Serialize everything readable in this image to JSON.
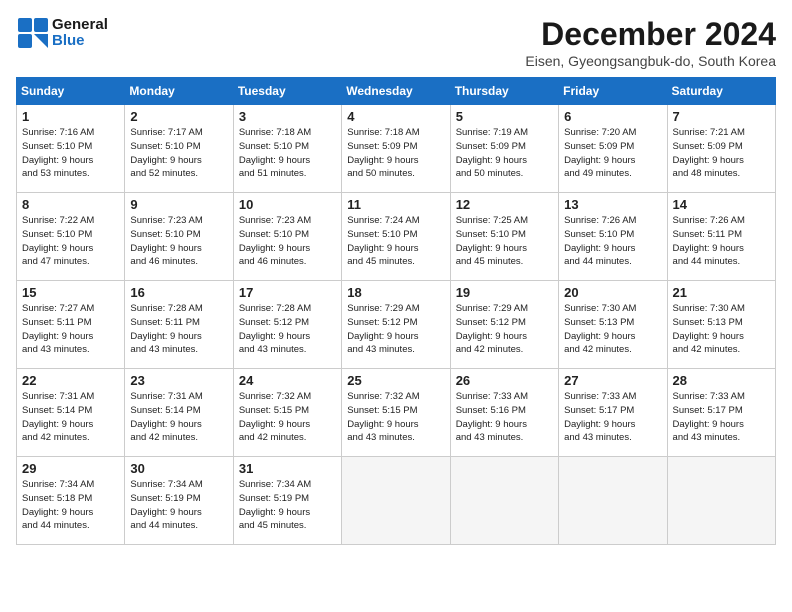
{
  "header": {
    "logo_general": "General",
    "logo_blue": "Blue",
    "month_title": "December 2024",
    "location": "Eisen, Gyeongsangbuk-do, South Korea"
  },
  "weekdays": [
    "Sunday",
    "Monday",
    "Tuesday",
    "Wednesday",
    "Thursday",
    "Friday",
    "Saturday"
  ],
  "weeks": [
    [
      {
        "day": 1,
        "info": "Sunrise: 7:16 AM\nSunset: 5:10 PM\nDaylight: 9 hours\nand 53 minutes."
      },
      {
        "day": 2,
        "info": "Sunrise: 7:17 AM\nSunset: 5:10 PM\nDaylight: 9 hours\nand 52 minutes."
      },
      {
        "day": 3,
        "info": "Sunrise: 7:18 AM\nSunset: 5:10 PM\nDaylight: 9 hours\nand 51 minutes."
      },
      {
        "day": 4,
        "info": "Sunrise: 7:18 AM\nSunset: 5:09 PM\nDaylight: 9 hours\nand 50 minutes."
      },
      {
        "day": 5,
        "info": "Sunrise: 7:19 AM\nSunset: 5:09 PM\nDaylight: 9 hours\nand 50 minutes."
      },
      {
        "day": 6,
        "info": "Sunrise: 7:20 AM\nSunset: 5:09 PM\nDaylight: 9 hours\nand 49 minutes."
      },
      {
        "day": 7,
        "info": "Sunrise: 7:21 AM\nSunset: 5:09 PM\nDaylight: 9 hours\nand 48 minutes."
      }
    ],
    [
      {
        "day": 8,
        "info": "Sunrise: 7:22 AM\nSunset: 5:10 PM\nDaylight: 9 hours\nand 47 minutes."
      },
      {
        "day": 9,
        "info": "Sunrise: 7:23 AM\nSunset: 5:10 PM\nDaylight: 9 hours\nand 46 minutes."
      },
      {
        "day": 10,
        "info": "Sunrise: 7:23 AM\nSunset: 5:10 PM\nDaylight: 9 hours\nand 46 minutes."
      },
      {
        "day": 11,
        "info": "Sunrise: 7:24 AM\nSunset: 5:10 PM\nDaylight: 9 hours\nand 45 minutes."
      },
      {
        "day": 12,
        "info": "Sunrise: 7:25 AM\nSunset: 5:10 PM\nDaylight: 9 hours\nand 45 minutes."
      },
      {
        "day": 13,
        "info": "Sunrise: 7:26 AM\nSunset: 5:10 PM\nDaylight: 9 hours\nand 44 minutes."
      },
      {
        "day": 14,
        "info": "Sunrise: 7:26 AM\nSunset: 5:11 PM\nDaylight: 9 hours\nand 44 minutes."
      }
    ],
    [
      {
        "day": 15,
        "info": "Sunrise: 7:27 AM\nSunset: 5:11 PM\nDaylight: 9 hours\nand 43 minutes."
      },
      {
        "day": 16,
        "info": "Sunrise: 7:28 AM\nSunset: 5:11 PM\nDaylight: 9 hours\nand 43 minutes."
      },
      {
        "day": 17,
        "info": "Sunrise: 7:28 AM\nSunset: 5:12 PM\nDaylight: 9 hours\nand 43 minutes."
      },
      {
        "day": 18,
        "info": "Sunrise: 7:29 AM\nSunset: 5:12 PM\nDaylight: 9 hours\nand 43 minutes."
      },
      {
        "day": 19,
        "info": "Sunrise: 7:29 AM\nSunset: 5:12 PM\nDaylight: 9 hours\nand 42 minutes."
      },
      {
        "day": 20,
        "info": "Sunrise: 7:30 AM\nSunset: 5:13 PM\nDaylight: 9 hours\nand 42 minutes."
      },
      {
        "day": 21,
        "info": "Sunrise: 7:30 AM\nSunset: 5:13 PM\nDaylight: 9 hours\nand 42 minutes."
      }
    ],
    [
      {
        "day": 22,
        "info": "Sunrise: 7:31 AM\nSunset: 5:14 PM\nDaylight: 9 hours\nand 42 minutes."
      },
      {
        "day": 23,
        "info": "Sunrise: 7:31 AM\nSunset: 5:14 PM\nDaylight: 9 hours\nand 42 minutes."
      },
      {
        "day": 24,
        "info": "Sunrise: 7:32 AM\nSunset: 5:15 PM\nDaylight: 9 hours\nand 42 minutes."
      },
      {
        "day": 25,
        "info": "Sunrise: 7:32 AM\nSunset: 5:15 PM\nDaylight: 9 hours\nand 43 minutes."
      },
      {
        "day": 26,
        "info": "Sunrise: 7:33 AM\nSunset: 5:16 PM\nDaylight: 9 hours\nand 43 minutes."
      },
      {
        "day": 27,
        "info": "Sunrise: 7:33 AM\nSunset: 5:17 PM\nDaylight: 9 hours\nand 43 minutes."
      },
      {
        "day": 28,
        "info": "Sunrise: 7:33 AM\nSunset: 5:17 PM\nDaylight: 9 hours\nand 43 minutes."
      }
    ],
    [
      {
        "day": 29,
        "info": "Sunrise: 7:34 AM\nSunset: 5:18 PM\nDaylight: 9 hours\nand 44 minutes."
      },
      {
        "day": 30,
        "info": "Sunrise: 7:34 AM\nSunset: 5:19 PM\nDaylight: 9 hours\nand 44 minutes."
      },
      {
        "day": 31,
        "info": "Sunrise: 7:34 AM\nSunset: 5:19 PM\nDaylight: 9 hours\nand 45 minutes."
      },
      null,
      null,
      null,
      null
    ]
  ]
}
